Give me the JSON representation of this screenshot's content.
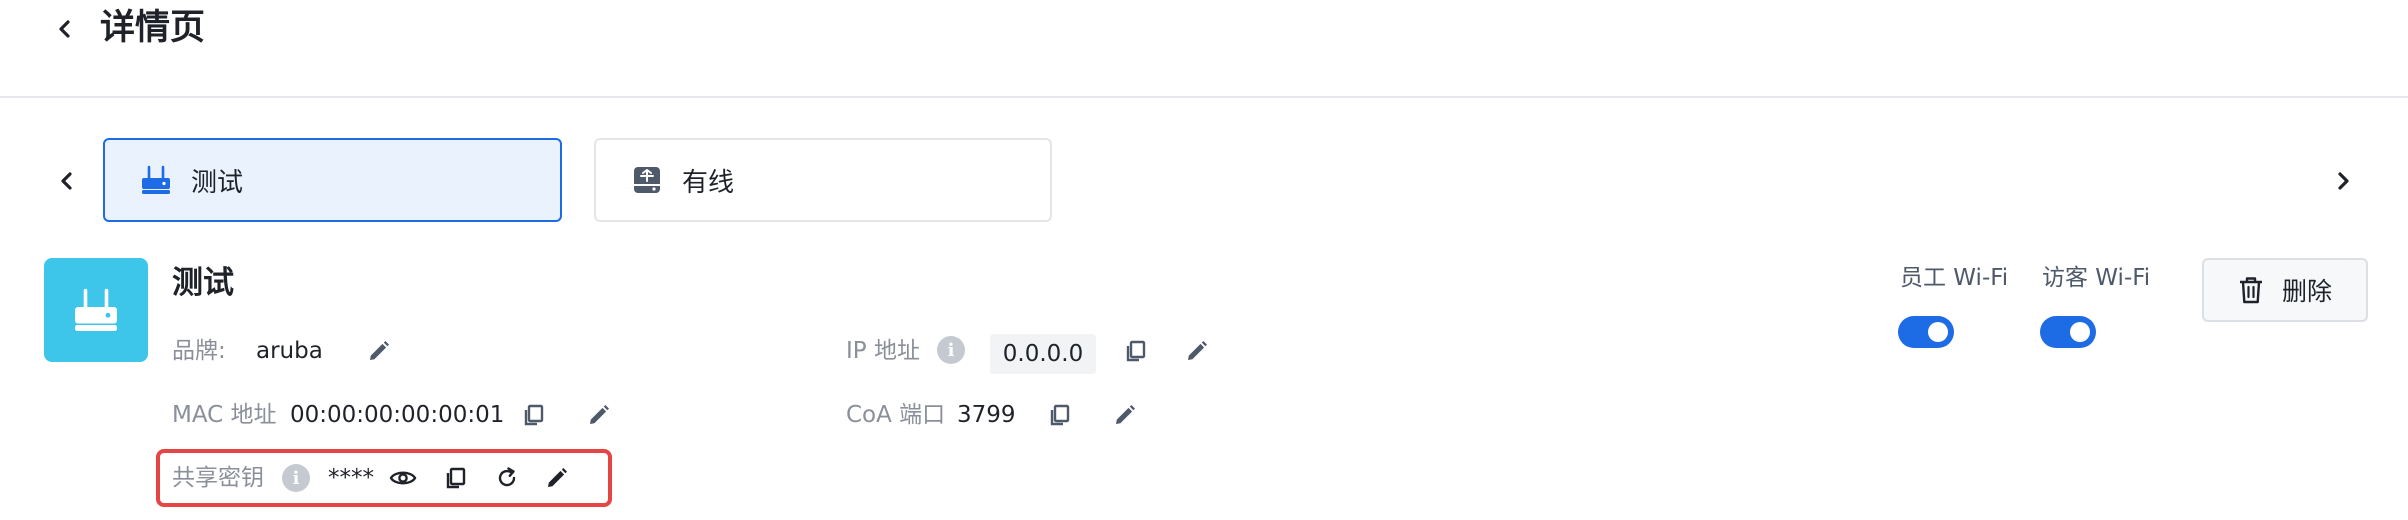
{
  "header": {
    "title": "详情页"
  },
  "tabs": [
    {
      "label": "测试",
      "icon": "router-icon"
    },
    {
      "label": "有线",
      "icon": "switch-icon"
    }
  ],
  "device": {
    "name": "测试",
    "brand_label": "品牌:",
    "brand_value": "aruba",
    "mac_label": "MAC 地址",
    "mac_value": "00:00:00:00:00:01",
    "secret_label": "共享密钥",
    "secret_value": "****",
    "ip_label": "IP 地址",
    "ip_value": "0.0.0.0",
    "coa_label": "CoA 端口",
    "coa_value": "3799"
  },
  "toggles": {
    "staff_label": "员工 Wi-Fi",
    "staff_on": true,
    "guest_label": "访客 Wi-Fi",
    "guest_on": true
  },
  "actions": {
    "delete_label": "删除"
  },
  "colors": {
    "accent": "#1e6be6",
    "avatar": "#3ec6ea",
    "highlight": "#e64545",
    "muted": "#8a8f99"
  }
}
